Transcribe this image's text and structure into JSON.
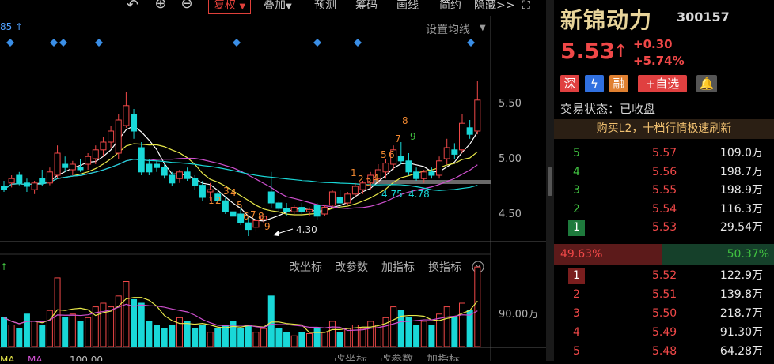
{
  "toolbar": {
    "undo_icon": "undo-arrow",
    "zoom_in": "⊕",
    "zoom_out": "⊖",
    "restore_rights": "复权",
    "overlay": "叠加",
    "forecast": "预测",
    "chips": "筹码",
    "draw_line": "画线",
    "simple": "简约",
    "hide": "隐藏>>",
    "fullscreen_icon": "expand-corners"
  },
  "chart": {
    "ma_value_partial": "85 ↑",
    "ma_settings": "设置均线",
    "price_ticks": [
      "5.50",
      "5.00",
      "4.50"
    ],
    "low_label": "4.30",
    "ma_labels": [
      "4.75",
      "4.78"
    ],
    "indicator_menu": [
      "改坐标",
      "改参数",
      "加指标",
      "换指标"
    ],
    "volume_tick": "90.00万",
    "bottom_partial": [
      "100.00",
      "改坐标",
      "改参数",
      "加指标",
      "换指标"
    ],
    "td_down_labels": [
      "1",
      "2",
      "3",
      "4",
      "5",
      "6",
      "7",
      "8",
      "9"
    ],
    "td_up_labels": [
      "1",
      "2",
      "3",
      "4",
      "5",
      "6",
      "7",
      "8",
      "9"
    ]
  },
  "quote": {
    "name": "新锦动力",
    "code": "300157",
    "price": "5.53",
    "change": "+0.30",
    "change_pct": "+5.74%",
    "tags": [
      "深",
      "ϟ",
      "融",
      "+自选"
    ],
    "bell_icon": "bell",
    "status": "交易状态：已收盘",
    "banner": "购买L2，十档行情极速刷新",
    "asks": [
      {
        "level": "5",
        "price": "5.57",
        "vol": "109.0万"
      },
      {
        "level": "4",
        "price": "5.56",
        "vol": "198.7万"
      },
      {
        "level": "3",
        "price": "5.55",
        "vol": "198.9万"
      },
      {
        "level": "2",
        "price": "5.54",
        "vol": "116.3万"
      },
      {
        "level": "1",
        "price": "5.53",
        "vol": "29.54万"
      }
    ],
    "buy_ratio": "49.63%",
    "sell_ratio": "50.37%",
    "bids": [
      {
        "level": "1",
        "price": "5.52",
        "vol": "122.9万"
      },
      {
        "level": "2",
        "price": "5.51",
        "vol": "139.8万"
      },
      {
        "level": "3",
        "price": "5.50",
        "vol": "218.7万"
      },
      {
        "level": "4",
        "price": "5.49",
        "vol": "91.30万"
      },
      {
        "level": "5",
        "price": "5.48",
        "vol": "64.28万"
      }
    ]
  },
  "colors": {
    "up": "#f04848",
    "down": "#19d8d8",
    "ma5": "#ffffff",
    "ma10": "#e8e84a",
    "ma20": "#d050d0",
    "ma60": "#19d8d8",
    "ask_level": "#40c040",
    "bid_level": "#f04848"
  },
  "chart_data": {
    "type": "candlestick",
    "y_ticks": [
      5.5,
      5.0,
      4.5
    ],
    "ylim": [
      4.2,
      5.8
    ],
    "candles": [
      {
        "o": 4.75,
        "h": 4.8,
        "l": 4.7,
        "c": 4.72
      },
      {
        "o": 4.78,
        "h": 4.85,
        "l": 4.74,
        "c": 4.82
      },
      {
        "o": 4.85,
        "h": 4.88,
        "l": 4.76,
        "c": 4.78
      },
      {
        "o": 4.78,
        "h": 4.82,
        "l": 4.7,
        "c": 4.75
      },
      {
        "o": 4.72,
        "h": 4.8,
        "l": 4.68,
        "c": 4.78
      },
      {
        "o": 4.82,
        "h": 4.9,
        "l": 4.75,
        "c": 4.78
      },
      {
        "o": 4.78,
        "h": 4.92,
        "l": 4.76,
        "c": 4.88
      },
      {
        "o": 4.85,
        "h": 5.12,
        "l": 4.82,
        "c": 5.05
      },
      {
        "o": 4.95,
        "h": 5.02,
        "l": 4.88,
        "c": 4.92
      },
      {
        "o": 4.9,
        "h": 4.98,
        "l": 4.85,
        "c": 4.95
      },
      {
        "o": 4.92,
        "h": 5.0,
        "l": 4.88,
        "c": 4.9
      },
      {
        "o": 4.95,
        "h": 5.05,
        "l": 4.9,
        "c": 5.02
      },
      {
        "o": 5.0,
        "h": 5.12,
        "l": 4.95,
        "c": 5.08
      },
      {
        "o": 5.08,
        "h": 5.2,
        "l": 5.02,
        "c": 5.15
      },
      {
        "o": 5.15,
        "h": 5.3,
        "l": 5.1,
        "c": 5.25
      },
      {
        "o": 5.05,
        "h": 5.4,
        "l": 5.0,
        "c": 5.35
      },
      {
        "o": 5.3,
        "h": 5.6,
        "l": 5.28,
        "c": 5.48
      },
      {
        "o": 5.4,
        "h": 5.45,
        "l": 5.18,
        "c": 5.25
      },
      {
        "o": 5.1,
        "h": 5.15,
        "l": 4.85,
        "c": 4.88
      },
      {
        "o": 4.95,
        "h": 5.0,
        "l": 4.85,
        "c": 4.88
      },
      {
        "o": 4.95,
        "h": 4.98,
        "l": 4.88,
        "c": 4.92
      },
      {
        "o": 4.92,
        "h": 4.95,
        "l": 4.82,
        "c": 4.85
      },
      {
        "o": 4.85,
        "h": 4.88,
        "l": 4.75,
        "c": 4.78
      },
      {
        "o": 4.82,
        "h": 4.9,
        "l": 4.78,
        "c": 4.88
      },
      {
        "o": 4.88,
        "h": 4.92,
        "l": 4.8,
        "c": 4.82
      },
      {
        "o": 4.82,
        "h": 4.85,
        "l": 4.72,
        "c": 4.76
      },
      {
        "o": 4.76,
        "h": 4.8,
        "l": 4.62,
        "c": 4.65
      },
      {
        "o": 4.7,
        "h": 4.78,
        "l": 4.62,
        "c": 4.72
      },
      {
        "o": 4.68,
        "h": 4.7,
        "l": 4.6,
        "c": 4.62
      },
      {
        "o": 4.62,
        "h": 4.65,
        "l": 4.5,
        "c": 4.52
      },
      {
        "o": 4.52,
        "h": 4.58,
        "l": 4.45,
        "c": 4.48
      },
      {
        "o": 4.5,
        "h": 4.55,
        "l": 4.4,
        "c": 4.42
      },
      {
        "o": 4.42,
        "h": 4.48,
        "l": 4.3,
        "c": 4.36
      },
      {
        "o": 4.38,
        "h": 4.46,
        "l": 4.34,
        "c": 4.44
      },
      {
        "o": 4.45,
        "h": 4.5,
        "l": 4.42,
        "c": 4.48
      },
      {
        "o": 4.7,
        "h": 4.88,
        "l": 4.55,
        "c": 4.6
      },
      {
        "o": 4.6,
        "h": 4.62,
        "l": 4.52,
        "c": 4.55
      },
      {
        "o": 4.55,
        "h": 4.6,
        "l": 4.48,
        "c": 4.52
      },
      {
        "o": 4.52,
        "h": 4.58,
        "l": 4.48,
        "c": 4.56
      },
      {
        "o": 4.56,
        "h": 4.6,
        "l": 4.5,
        "c": 4.52
      },
      {
        "o": 4.52,
        "h": 4.56,
        "l": 4.48,
        "c": 4.54
      },
      {
        "o": 4.58,
        "h": 4.6,
        "l": 4.45,
        "c": 4.48
      },
      {
        "o": 4.5,
        "h": 4.58,
        "l": 4.48,
        "c": 4.56
      },
      {
        "o": 4.58,
        "h": 4.72,
        "l": 4.55,
        "c": 4.7
      },
      {
        "o": 4.65,
        "h": 4.72,
        "l": 4.55,
        "c": 4.6
      },
      {
        "o": 4.6,
        "h": 4.7,
        "l": 4.58,
        "c": 4.68
      },
      {
        "o": 4.68,
        "h": 4.78,
        "l": 4.65,
        "c": 4.75
      },
      {
        "o": 4.72,
        "h": 4.8,
        "l": 4.68,
        "c": 4.78
      },
      {
        "o": 4.78,
        "h": 4.88,
        "l": 4.72,
        "c": 4.85
      },
      {
        "o": 4.82,
        "h": 4.95,
        "l": 4.78,
        "c": 4.9
      },
      {
        "o": 4.88,
        "h": 5.0,
        "l": 4.82,
        "c": 4.96
      },
      {
        "o": 4.95,
        "h": 5.12,
        "l": 4.9,
        "c": 5.08
      },
      {
        "o": 5.02,
        "h": 5.15,
        "l": 4.95,
        "c": 4.98
      },
      {
        "o": 4.98,
        "h": 5.05,
        "l": 4.85,
        "c": 4.88
      },
      {
        "o": 4.88,
        "h": 4.92,
        "l": 4.8,
        "c": 4.82
      },
      {
        "o": 4.82,
        "h": 4.9,
        "l": 4.78,
        "c": 4.88
      },
      {
        "o": 4.88,
        "h": 4.92,
        "l": 4.82,
        "c": 4.85
      },
      {
        "o": 4.85,
        "h": 5.02,
        "l": 4.82,
        "c": 4.98
      },
      {
        "o": 5.0,
        "h": 5.18,
        "l": 4.95,
        "c": 5.1
      },
      {
        "o": 5.08,
        "h": 5.14,
        "l": 5.0,
        "c": 5.04
      },
      {
        "o": 5.08,
        "h": 5.4,
        "l": 5.05,
        "c": 5.32
      },
      {
        "o": 5.28,
        "h": 5.35,
        "l": 5.18,
        "c": 5.22
      },
      {
        "o": 5.25,
        "h": 5.7,
        "l": 5.22,
        "c": 5.53
      }
    ],
    "volume": [
      40,
      30,
      25,
      45,
      35,
      30,
      50,
      95,
      40,
      45,
      35,
      40,
      55,
      60,
      55,
      70,
      90,
      65,
      60,
      35,
      30,
      25,
      30,
      40,
      35,
      25,
      30,
      20,
      25,
      30,
      35,
      25,
      30,
      20,
      25,
      70,
      25,
      20,
      15,
      20,
      18,
      25,
      20,
      35,
      20,
      25,
      30,
      25,
      35,
      30,
      40,
      55,
      50,
      40,
      30,
      35,
      30,
      45,
      55,
      40,
      60,
      50,
      110
    ]
  }
}
